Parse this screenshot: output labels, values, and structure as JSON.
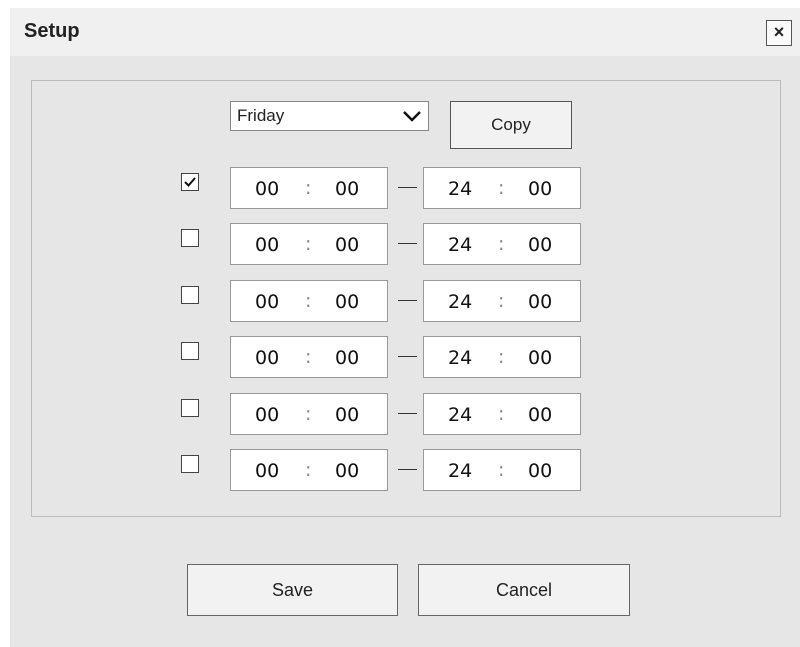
{
  "dialog": {
    "title": "Setup",
    "close_label": "×"
  },
  "schedule": {
    "day": "Friday",
    "copy_label": "Copy",
    "time_separator": ":",
    "periods": [
      {
        "checked": true,
        "start_hour": "00",
        "start_minute": "00",
        "end_hour": "24",
        "end_minute": "00"
      },
      {
        "checked": false,
        "start_hour": "00",
        "start_minute": "00",
        "end_hour": "24",
        "end_minute": "00"
      },
      {
        "checked": false,
        "start_hour": "00",
        "start_minute": "00",
        "end_hour": "24",
        "end_minute": "00"
      },
      {
        "checked": false,
        "start_hour": "00",
        "start_minute": "00",
        "end_hour": "24",
        "end_minute": "00"
      },
      {
        "checked": false,
        "start_hour": "00",
        "start_minute": "00",
        "end_hour": "24",
        "end_minute": "00"
      },
      {
        "checked": false,
        "start_hour": "00",
        "start_minute": "00",
        "end_hour": "24",
        "end_minute": "00"
      }
    ]
  },
  "footer": {
    "save_label": "Save",
    "cancel_label": "Cancel"
  }
}
